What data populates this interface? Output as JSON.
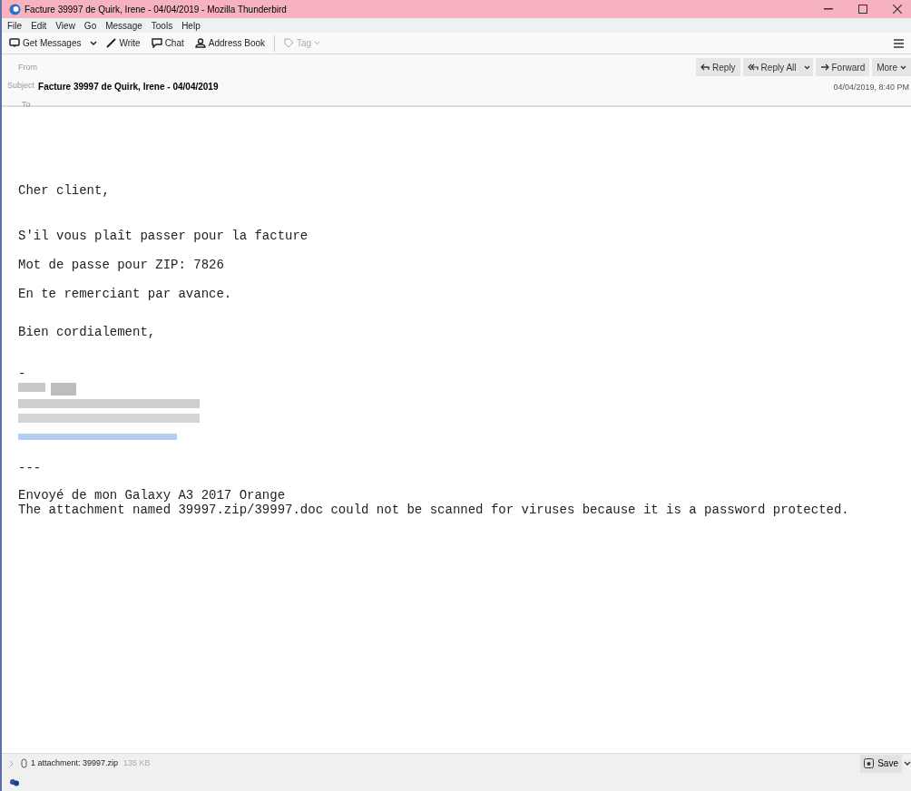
{
  "window": {
    "title": "Facture 39997 de Quirk, Irene - 04/04/2019 - Mozilla Thunderbird"
  },
  "menu": [
    "File",
    "Edit",
    "View",
    "Go",
    "Message",
    "Tools",
    "Help"
  ],
  "toolbar": [
    {
      "kind": "get",
      "label": "Get Messages",
      "disabled": false
    },
    {
      "kind": "write",
      "label": "Write",
      "disabled": false
    },
    {
      "kind": "chat",
      "label": "Chat",
      "disabled": false
    },
    {
      "kind": "book",
      "label": "Address Book",
      "disabled": false
    },
    {
      "kind": "tag",
      "label": "Tag",
      "disabled": true
    }
  ],
  "header": {
    "from_label": "From",
    "subject_label": "Subject",
    "subject": "Facture 39997 de Quirk, Irene - 04/04/2019",
    "to_label": "To",
    "date": "04/04/2019, 8:40 PM",
    "actions": [
      {
        "kind": "reply",
        "label": "Reply"
      },
      {
        "kind": "replyall",
        "label": "Reply All"
      },
      {
        "kind": "forward",
        "label": "Forward"
      },
      {
        "kind": "more",
        "label": "More"
      }
    ]
  },
  "body": [
    {
      "kind": "text",
      "lines": [
        "Cher client,"
      ]
    },
    {
      "kind": "text",
      "lines": [
        "S'il vous plaît passer pour la facture"
      ]
    },
    {
      "kind": "text",
      "lines": [
        "Mot de passe pour ZIP: 7826"
      ]
    },
    {
      "kind": "text",
      "lines": [
        "En te remerciant par avance."
      ]
    },
    {
      "kind": "text",
      "lines": [
        "Bien cordialement,"
      ]
    },
    {
      "kind": "text",
      "lines": [
        "-"
      ]
    },
    {
      "kind": "redacted"
    },
    {
      "kind": "text",
      "lines": [
        "---"
      ]
    },
    {
      "kind": "text",
      "lines": [
        "Envoyé de mon Galaxy A3 2017 Orange",
        "The attachment named 39997.zip/39997.doc could not be scanned for viruses because it is a password protected."
      ]
    }
  ],
  "attachment": {
    "summary": "1 attachment: 39997.zip",
    "size": "135 KB",
    "save": "Save"
  }
}
